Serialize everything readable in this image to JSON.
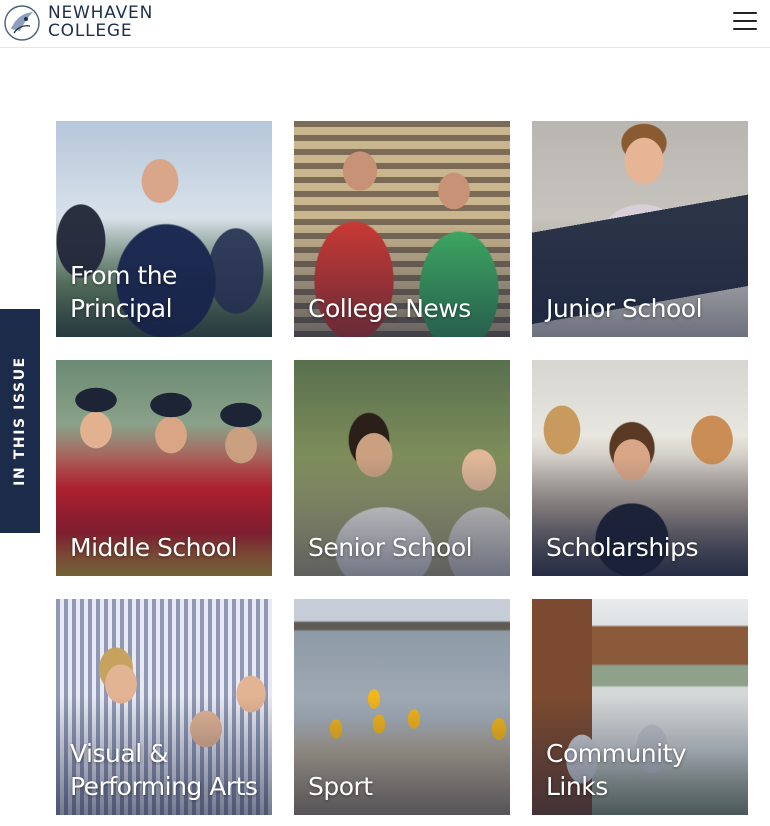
{
  "header": {
    "brand_line1": "NEWHAVEN",
    "brand_line2": "COLLEGE",
    "logo_icon": "college-crest-icon",
    "menu_icon": "hamburger-menu-icon"
  },
  "side_tab": {
    "label": "IN THIS ISSUE"
  },
  "tiles": [
    {
      "label": "From the\nPrincipal"
    },
    {
      "label": "College News"
    },
    {
      "label": "Junior School"
    },
    {
      "label": "Middle School"
    },
    {
      "label": "Senior School"
    },
    {
      "label": "Scholarships"
    },
    {
      "label": "Visual &\nPerforming Arts"
    },
    {
      "label": "Sport"
    },
    {
      "label": "Community\nLinks"
    }
  ],
  "colors": {
    "brand_navy": "#1c2b4a",
    "header_text": "#1e2f4d",
    "background": "#ffffff"
  }
}
